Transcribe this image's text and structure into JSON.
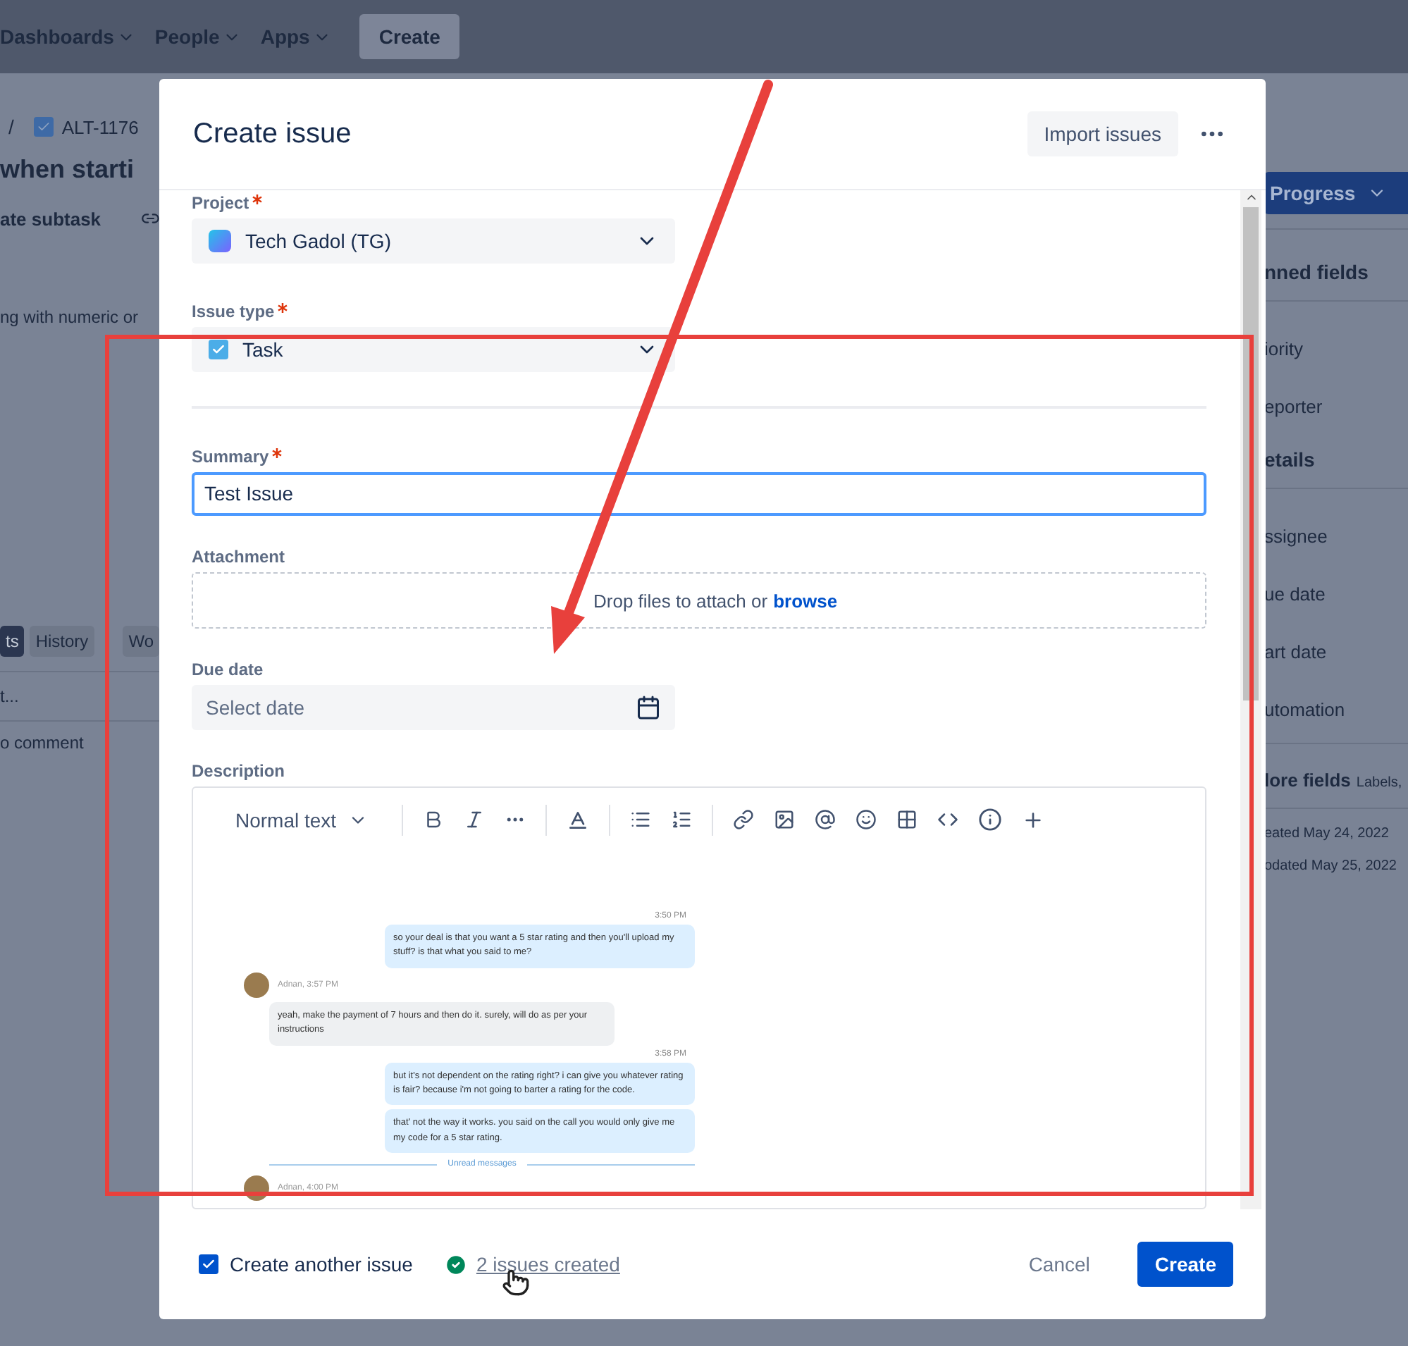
{
  "background_page": {
    "nav": [
      {
        "label": "Dashboards"
      },
      {
        "label": "People"
      },
      {
        "label": "Apps"
      }
    ],
    "create_button": "Create",
    "breadcrumb": {
      "separator": "/",
      "issue_key": "ALT-1176"
    },
    "title": "when starti",
    "action": "ate subtask",
    "description": "ng with numeric or",
    "tabs": [
      {
        "label": "ts",
        "selected": true
      },
      {
        "label": "History",
        "selected": false
      },
      {
        "label": "Wo",
        "selected": false
      }
    ],
    "comment_field": "t...",
    "comment_hint": "o comment",
    "status_button": "Progress",
    "side_items": [
      {
        "kind": "heading",
        "text": "nned fields"
      },
      {
        "kind": "field",
        "text": "iority"
      },
      {
        "kind": "field",
        "text": "eporter"
      },
      {
        "kind": "heading",
        "text": "etails"
      },
      {
        "kind": "field",
        "text": "ssignee"
      },
      {
        "kind": "field",
        "text": "ue date"
      },
      {
        "kind": "field",
        "text": "art date"
      },
      {
        "kind": "field",
        "text": "utomation"
      },
      {
        "kind": "more",
        "text": "lore fields",
        "hint": "Labels,"
      },
      {
        "kind": "meta",
        "text": "eated May 24, 2022"
      },
      {
        "kind": "meta",
        "text": "odated May 25, 2022"
      }
    ]
  },
  "dialog": {
    "title": "Create issue",
    "import_button": "Import issues",
    "project": {
      "label": "Project",
      "required": true,
      "value": "Tech Gadol (TG)"
    },
    "issue_type": {
      "label": "Issue type",
      "required": true,
      "value": "Task"
    },
    "summary": {
      "label": "Summary",
      "required": true,
      "value": "Test Issue",
      "focused": true
    },
    "attachment": {
      "label": "Attachment",
      "text": "Drop files to attach or",
      "link": "browse"
    },
    "due_date": {
      "label": "Due date",
      "placeholder": "Select date"
    },
    "description": {
      "label": "Description",
      "text_style": "Normal text",
      "chat": [
        {
          "kind": "time",
          "text": "3:50 PM"
        },
        {
          "kind": "out",
          "text": "so your deal is that you want a 5 star rating and then you'll upload my stuff?  is that what you said to me?"
        },
        {
          "kind": "sender",
          "text": "Adnan, 3:57 PM"
        },
        {
          "kind": "in",
          "text": "yeah, make the payment of 7 hours and then do it. surely, will do as per your instructions"
        },
        {
          "kind": "time",
          "text": "3:58 PM"
        },
        {
          "kind": "out",
          "text": "but it's not dependent on the rating right?  i can give you whatever rating is fair?  because i'm not going to barter a rating for the code."
        },
        {
          "kind": "out",
          "text": "that' not the way it works.  you said on the call you would only give me my code for a 5 star rating."
        },
        {
          "kind": "divider",
          "text": "Unread messages"
        },
        {
          "kind": "sender",
          "text": "Adnan, 4:00 PM"
        }
      ]
    },
    "footer": {
      "create_another": {
        "label": "Create another issue",
        "checked": true
      },
      "success_link": "2 issues created",
      "cancel_button": "Cancel",
      "create_button": "Create"
    }
  }
}
